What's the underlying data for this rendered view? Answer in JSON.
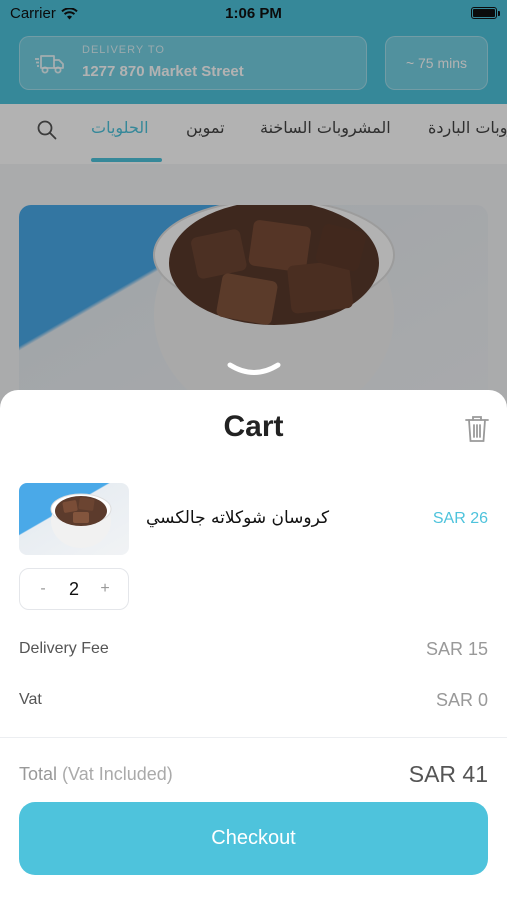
{
  "status_bar": {
    "carrier": "Carrier",
    "time": "1:06 PM"
  },
  "header": {
    "delivery_label": "DELIVERY TO",
    "delivery_address": "1277 870 Market Street",
    "eta": "~ 75 mins"
  },
  "tabs": [
    {
      "label": "الحلويات",
      "active": true
    },
    {
      "label": "تموين",
      "active": false
    },
    {
      "label": "المشروبات الساخنة",
      "active": false
    },
    {
      "label": "المشروبات الباردة",
      "active": false
    }
  ],
  "cart": {
    "title": "Cart",
    "item": {
      "name": "كروسان شوكلاته جالكسي",
      "price": "SAR 26",
      "quantity": "2",
      "decrement_label": "-",
      "increment_label": "+"
    },
    "delivery_fee_label": "Delivery Fee",
    "delivery_fee_value": "SAR 15",
    "vat_label": "Vat",
    "vat_value": "SAR 0",
    "total_label": "Total",
    "total_sub_label": "(Vat Included)",
    "total_value": "SAR 41",
    "checkout_label": "Checkout"
  },
  "colors": {
    "accent": "#4ec3dc",
    "price": "#4ec3dc"
  },
  "icons": {
    "search": "search-icon",
    "truck": "truck-icon",
    "trash": "trash-icon",
    "wifi": "wifi-icon",
    "battery": "battery-icon",
    "handle": "chevron-down-icon"
  }
}
